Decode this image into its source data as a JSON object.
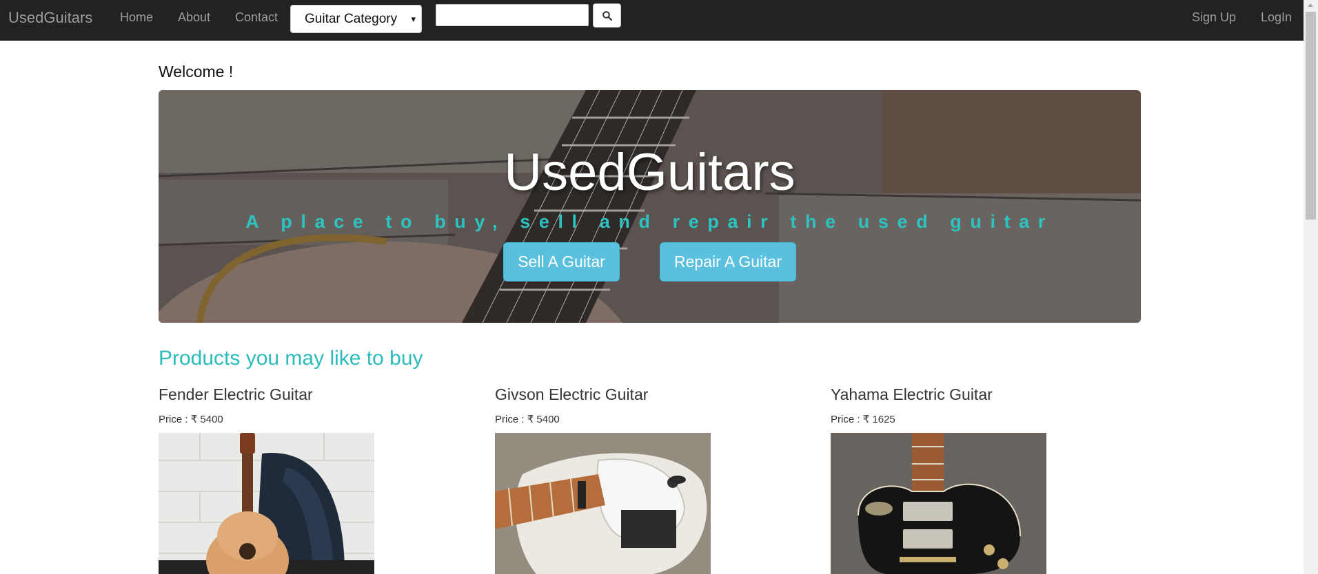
{
  "navbar": {
    "brand": "UsedGuitars",
    "links": {
      "home": "Home",
      "about": "About",
      "contact": "Contact"
    },
    "category_select": {
      "selected": "Guitar Category",
      "caret": "▾"
    },
    "search": {
      "value": "",
      "placeholder": "",
      "icon": "search-icon"
    },
    "auth": {
      "signup": "Sign Up",
      "login": "LogIn"
    }
  },
  "welcome": "Welcome !",
  "hero": {
    "title": "UsedGuitars",
    "subtitle": "A place to buy, sell and repair the used guitar",
    "buttons": {
      "sell": "Sell A Guitar",
      "repair": "Repair A Guitar"
    }
  },
  "products": {
    "heading": "Products you may like to buy",
    "items": [
      {
        "name": "Fender Electric Guitar",
        "price_label": "Price :",
        "currency": "₹",
        "price": "5400"
      },
      {
        "name": "Givson Electric Guitar",
        "price_label": "Price :",
        "currency": "₹",
        "price": "5400"
      },
      {
        "name": "Yahama Electric Guitar",
        "price_label": "Price :",
        "currency": "₹",
        "price": "1625"
      }
    ]
  },
  "colors": {
    "navbar_bg": "#222222",
    "nav_text": "#9d9d9d",
    "accent_teal": "#2cc3c3",
    "button_info": "#5bc0de"
  }
}
